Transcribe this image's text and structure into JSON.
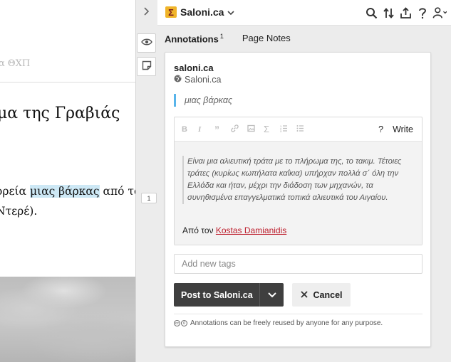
{
  "document": {
    "header_text": "α ΘΧΠ",
    "title": "μα της Γραβιάς",
    "line1_before": "ορεία ",
    "line1_highlight": "μιας βάρκας",
    "line1_after": " από το",
    "line2": "Ντερέ)."
  },
  "sidebar": {
    "bucket_count": "1"
  },
  "topbar": {
    "group_name": "Saloni.ca",
    "group_icon_glyph": "Σ"
  },
  "tabs": {
    "annotations_label": "Annotations",
    "annotations_count": "1",
    "page_notes_label": "Page Notes"
  },
  "annotation": {
    "user": "saloni.ca",
    "group": "Saloni.ca",
    "quote": "μιας βάρκας",
    "editor": {
      "help_label": "?",
      "write_label": "Write",
      "body_quote": "Είναι μια αλιευτική τράτα με το πλήρωμα της, το τακιμ. Τέτοιες τράτες (κυρίως κωπήλατα καΐκια) υπήρχαν πολλά σ΄ όλη την Ελλάδα και ήταν, μέχρι την διάδοση των μηχανών, τα συνηθισμένα επαγγελματικά τοπικά αλιευτικά του Αιγαίου.",
      "attribution_prefix": "Από τον ",
      "attribution_link": "Kostas Damianidis"
    },
    "tags_placeholder": "Add new tags",
    "post_label": "Post to Saloni.ca",
    "cancel_label": "Cancel",
    "license_text": "Annotations can be freely reused by anyone for any purpose."
  },
  "colors": {
    "highlight": "#cde8f5",
    "quote_bar": "#58b4ea",
    "post_button": "#3f3f3f",
    "link": "#bd1c2b",
    "group_icon_bg": "#f0b429"
  },
  "icons": [
    "chevron-right-icon",
    "sigma-icon",
    "chevron-down-icon",
    "search-icon",
    "sort-icon",
    "share-icon",
    "help-icon",
    "user-icon",
    "eye-icon",
    "page-note-icon",
    "globe-icon",
    "bold-icon",
    "italic-icon",
    "quote-icon",
    "link-icon",
    "image-icon",
    "math-icon",
    "numbered-list-icon",
    "bullet-list-icon",
    "close-icon",
    "creative-commons-icon"
  ]
}
